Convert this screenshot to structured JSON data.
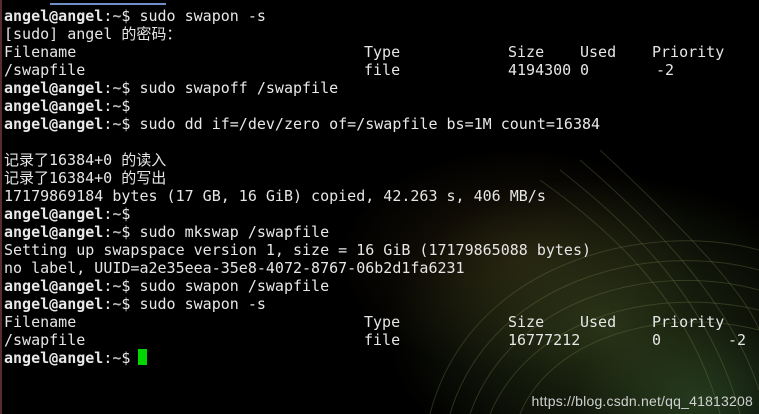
{
  "prompt": {
    "user": "angel@angel",
    "sep": ":",
    "path": "~",
    "symbol": "$"
  },
  "lines": {
    "cmd_swapon_s": "sudo swapon -s",
    "sudo_password": "[sudo] angel 的密码：",
    "cmd_swapoff": "sudo swapoff /swapfile",
    "cmd_dd": "sudo dd if=/dev/zero of=/swapfile bs=1M count=16384",
    "records_in": "记录了16384+0 的读入",
    "records_out": "记录了16384+0 的写出",
    "bytes_copied": "17179869184 bytes (17 GB, 16 GiB) copied, 42.263 s, 406 MB/s",
    "cmd_mkswap": "sudo mkswap /swapfile",
    "setting_up": "Setting up swapspace version 1, size = 16 GiB (17179865088 bytes)",
    "uuid": "no label, UUID=a2e35eea-35e8-4072-8767-06b2d1fa6231",
    "cmd_swapon_file": "sudo swapon /swapfile",
    "cmd_swapon_s2": "sudo swapon -s"
  },
  "table_headers": {
    "filename": "Filename",
    "type": "Type",
    "size": "Size",
    "used": "Used",
    "priority": "Priority"
  },
  "swap_table_before": {
    "filename": "/swapfile",
    "type": "file",
    "size": "4194300",
    "used": "0",
    "priority": "-2"
  },
  "swap_table_after": {
    "filename": "/swapfile",
    "type": "file",
    "size": "16777212",
    "used": "0",
    "priority": "-2"
  },
  "colors": {
    "background": "#000000",
    "text": "#e6e6e6",
    "cursor": "#00d600"
  },
  "watermark": "https://blog.csdn.net/qq_41813208"
}
